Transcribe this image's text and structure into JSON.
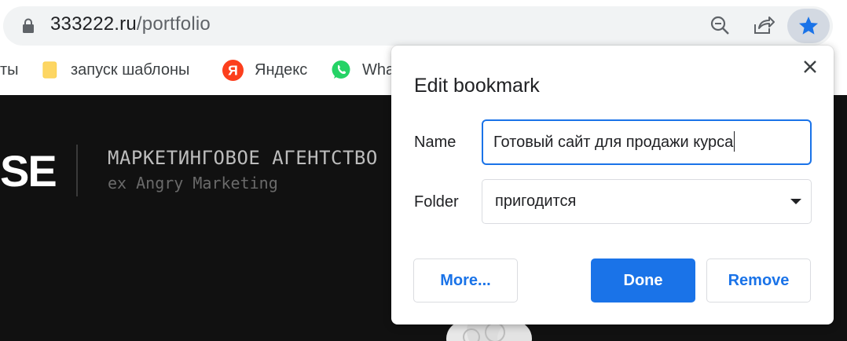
{
  "browser": {
    "url_host": "333222.ru",
    "url_path": "/portfolio",
    "bookmarks": [
      {
        "label": "ты",
        "icon": "none"
      },
      {
        "label": "запуск шаблоны",
        "icon": "folder-icon"
      },
      {
        "label": "Яндекс",
        "icon": "yandex-icon"
      },
      {
        "label": "Wha",
        "icon": "whatsapp-icon"
      }
    ]
  },
  "page": {
    "logo_fragment": "SE",
    "agency_title": "МАРКЕТИНГОВОЕ АГЕНТСТВО",
    "agency_subtitle": "ex Angry Marketing"
  },
  "dialog": {
    "title": "Edit bookmark",
    "name_label": "Name",
    "name_value": "Готовый сайт для продажи курса",
    "folder_label": "Folder",
    "folder_value": "пригодится",
    "more_label": "More...",
    "done_label": "Done",
    "remove_label": "Remove"
  },
  "colors": {
    "accent": "#1a73e8",
    "page_bg": "#111111",
    "star_active": "#1a73e8"
  }
}
